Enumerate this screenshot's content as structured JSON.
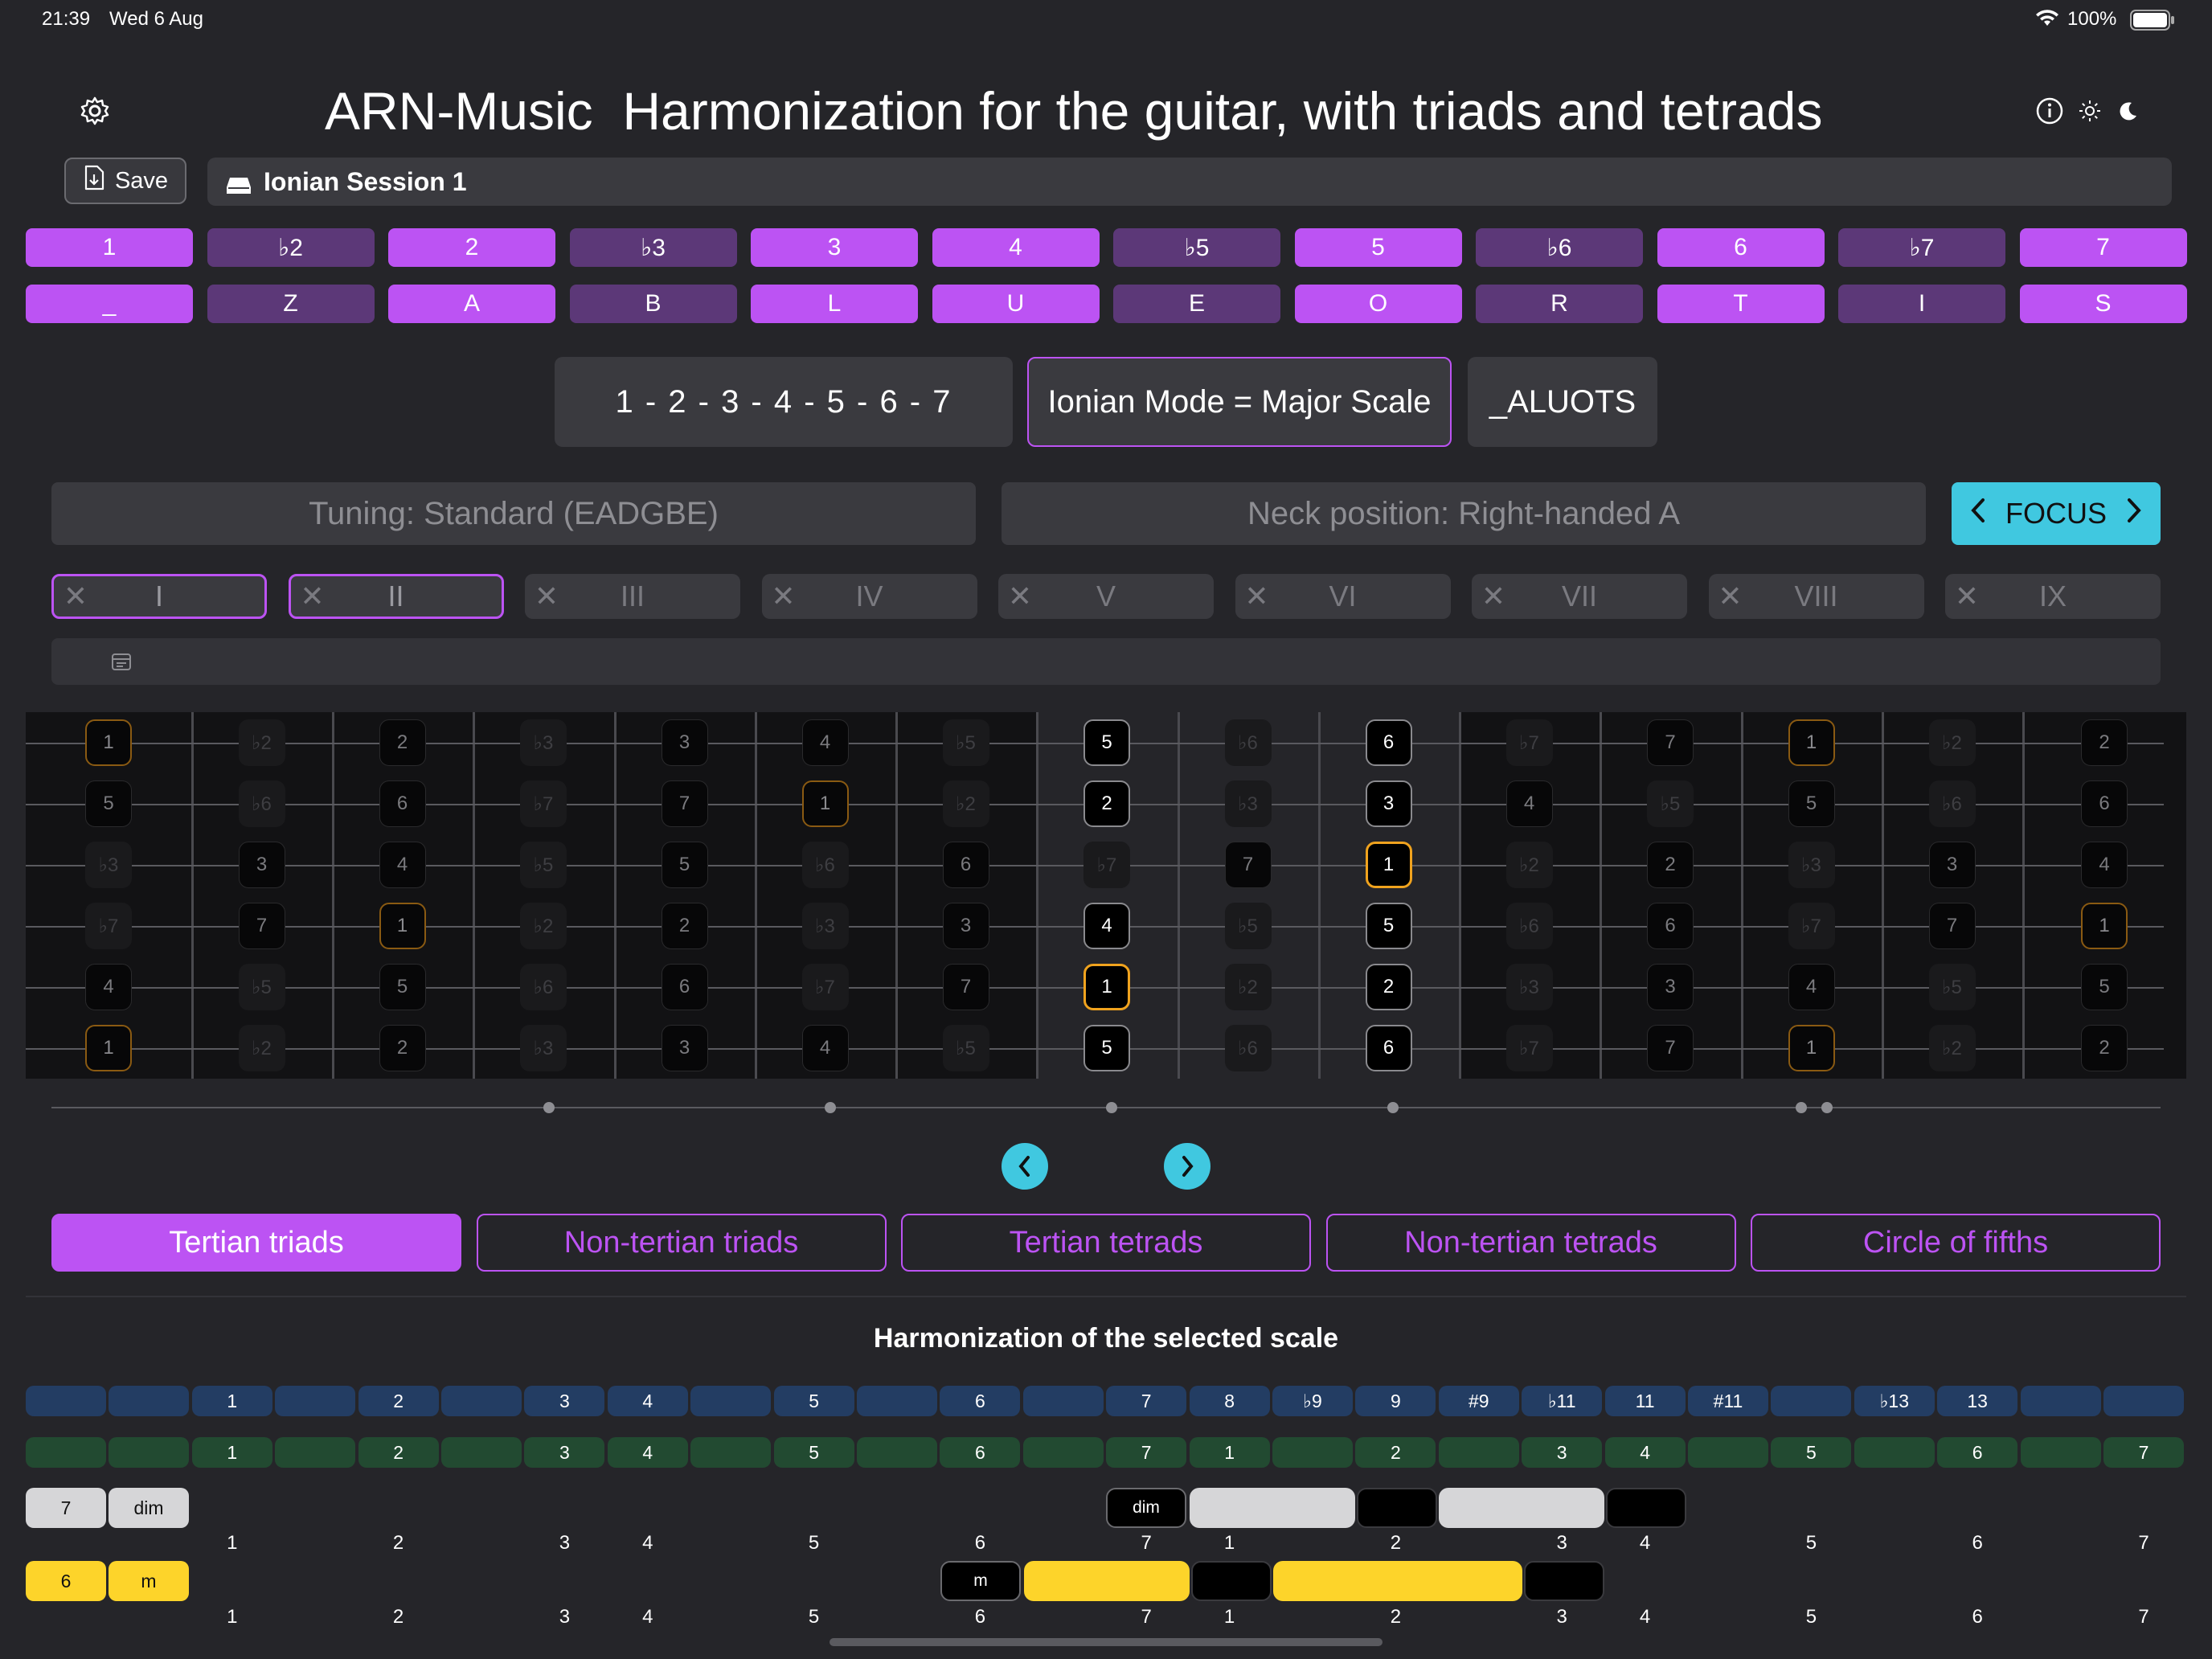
{
  "status": {
    "time": "21:39",
    "date": "Wed 6 Aug",
    "battery": "100%"
  },
  "header": {
    "app_name": "ARN-Music",
    "subtitle": "Harmonization for the guitar, with triads and tetrads"
  },
  "toolbar": {
    "save_label": "Save",
    "session_name": "Ionian Session 1"
  },
  "degrees_row1": [
    {
      "label": "1",
      "on": true
    },
    {
      "label": "♭2",
      "on": false
    },
    {
      "label": "2",
      "on": true
    },
    {
      "label": "♭3",
      "on": false
    },
    {
      "label": "3",
      "on": true
    },
    {
      "label": "4",
      "on": true
    },
    {
      "label": "♭5",
      "on": false
    },
    {
      "label": "5",
      "on": true
    },
    {
      "label": "♭6",
      "on": false
    },
    {
      "label": "6",
      "on": true
    },
    {
      "label": "♭7",
      "on": false
    },
    {
      "label": "7",
      "on": true
    }
  ],
  "degrees_row2": [
    {
      "label": "_",
      "on": true
    },
    {
      "label": "Z",
      "on": false
    },
    {
      "label": "A",
      "on": true
    },
    {
      "label": "B",
      "on": false
    },
    {
      "label": "L",
      "on": true
    },
    {
      "label": "U",
      "on": true
    },
    {
      "label": "E",
      "on": false
    },
    {
      "label": "O",
      "on": true
    },
    {
      "label": "R",
      "on": false
    },
    {
      "label": "T",
      "on": true
    },
    {
      "label": "I",
      "on": false
    },
    {
      "label": "S",
      "on": true
    }
  ],
  "scale": {
    "formula": "1 - 2 - 3 - 4 - 5 - 6 - 7",
    "mode_name": "Ionian Mode = Major Scale",
    "code": "_ALUOTS"
  },
  "settings": {
    "tuning": "Tuning: Standard (EADGBE)",
    "neck": "Neck position: Right-handed A",
    "focus": "FOCUS"
  },
  "positions": [
    {
      "label": "I",
      "selected": true
    },
    {
      "label": "II",
      "selected": true
    },
    {
      "label": "III",
      "selected": false
    },
    {
      "label": "IV",
      "selected": false
    },
    {
      "label": "V",
      "selected": false
    },
    {
      "label": "VI",
      "selected": false
    },
    {
      "label": "VII",
      "selected": false
    },
    {
      "label": "VIII",
      "selected": false
    },
    {
      "label": "IX",
      "selected": false
    }
  ],
  "fretboard": {
    "strings": [
      [
        "1",
        "♭2",
        "2",
        "♭3",
        "3",
        "4",
        "♭5",
        "5",
        "♭6",
        "6",
        "♭7",
        "7",
        "1",
        "♭2",
        "2"
      ],
      [
        "5",
        "♭6",
        "6",
        "♭7",
        "7",
        "1",
        "♭2",
        "2",
        "♭3",
        "3",
        "4",
        "♭5",
        "5",
        "♭6",
        "6"
      ],
      [
        "♭3",
        "3",
        "4",
        "♭5",
        "5",
        "♭6",
        "6",
        "♭7",
        "7",
        "1",
        "♭2",
        "2",
        "♭3",
        "3",
        "4"
      ],
      [
        "♭7",
        "7",
        "1",
        "♭2",
        "2",
        "♭3",
        "3",
        "4",
        "♭5",
        "5",
        "♭6",
        "6",
        "♭7",
        "7",
        "1"
      ],
      [
        "4",
        "♭5",
        "5",
        "♭6",
        "6",
        "♭7",
        "7",
        "1",
        "♭2",
        "2",
        "♭3",
        "3",
        "4",
        "♭5",
        "5"
      ],
      [
        "1",
        "♭2",
        "2",
        "♭3",
        "3",
        "4",
        "♭5",
        "5",
        "♭6",
        "6",
        "♭7",
        "7",
        "1",
        "♭2",
        "2"
      ]
    ],
    "highlight_frets": [
      7,
      9
    ]
  },
  "chord_tabs": [
    {
      "label": "Tertian triads",
      "on": true
    },
    {
      "label": "Non-tertian triads",
      "on": false
    },
    {
      "label": "Tertian tetrads",
      "on": false
    },
    {
      "label": "Non-tertian tetrads",
      "on": false
    },
    {
      "label": "Circle of fifths",
      "on": false
    }
  ],
  "harmonization": {
    "title": "Harmonization of the selected scale",
    "row_blue": [
      "",
      "",
      "1",
      "",
      "2",
      "",
      "3",
      "4",
      "",
      "5",
      "",
      "6",
      "",
      "7",
      "8",
      "♭9",
      "9",
      "#9",
      "♭11",
      "11",
      "#11",
      "",
      "♭13",
      "13",
      "",
      ""
    ],
    "row_green": [
      "",
      "",
      "1",
      "",
      "2",
      "",
      "3",
      "4",
      "",
      "5",
      "",
      "6",
      "",
      "7",
      "1",
      "",
      "2",
      "",
      "3",
      "4",
      "",
      "5",
      "",
      "6",
      "",
      "7"
    ],
    "interval_row": [
      "",
      "",
      "1",
      "",
      "2",
      "",
      "3",
      "4",
      "",
      "5",
      "",
      "6",
      "",
      "7",
      "1",
      "",
      "2",
      "",
      "3",
      "4",
      "",
      "5",
      "",
      "6",
      "",
      "7"
    ],
    "chord_1": {
      "degree": "7",
      "quality": "dim",
      "tag": "dim"
    },
    "chord_2": {
      "degree": "6",
      "quality": "m",
      "tag": "m"
    }
  },
  "colors": {
    "accent": "#bc53f3",
    "accent_dim": "#5c3878",
    "cyan": "#40c8e0",
    "yellow": "#fdd42a",
    "root_orange": "#f0a31e"
  }
}
